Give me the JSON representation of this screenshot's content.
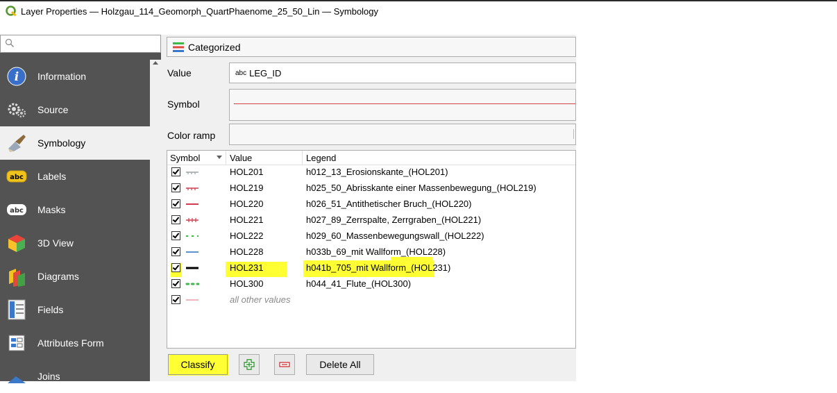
{
  "window": {
    "title": "Layer Properties — Holzgau_114_Geomorph_QuartPhaenome_25_50_Lin — Symbology"
  },
  "search": {
    "placeholder": ""
  },
  "sidebar": {
    "items": [
      {
        "label": "Information",
        "icon": "information-icon"
      },
      {
        "label": "Source",
        "icon": "source-icon"
      },
      {
        "label": "Symbology",
        "icon": "symbology-icon",
        "active": true
      },
      {
        "label": "Labels",
        "icon": "labels-icon"
      },
      {
        "label": "Masks",
        "icon": "masks-icon"
      },
      {
        "label": "3D View",
        "icon": "3d-view-icon"
      },
      {
        "label": "Diagrams",
        "icon": "diagrams-icon"
      },
      {
        "label": "Fields",
        "icon": "fields-icon"
      },
      {
        "label": "Attributes Form",
        "icon": "attributes-form-icon"
      },
      {
        "label": "Joins",
        "icon": "joins-icon"
      }
    ]
  },
  "renderer": {
    "label": "Categorized",
    "icon": "categorized-renderer-icon"
  },
  "fields": {
    "value_label": "Value",
    "value_type": "abc",
    "value": "LEG_ID",
    "symbol_label": "Symbol",
    "color_ramp_label": "Color ramp"
  },
  "table": {
    "headers": {
      "symbol": "Symbol",
      "value": "Value",
      "legend": "Legend"
    },
    "rows": [
      {
        "value": "HOL201",
        "legend": "h012_13_Erosionskante_(HOL201)",
        "color": "#9aa3a6",
        "style": "tick-line",
        "checked": true
      },
      {
        "value": "HOL219",
        "legend": "h025_50_Abrisskante einer Massenbewegung_(HOL219)",
        "color": "#d03c4c",
        "style": "tick-line",
        "checked": true
      },
      {
        "value": "HOL220",
        "legend": "h026_51_Antithetischer Bruch_(HOL220)",
        "color": "#d03c4c",
        "style": "solid",
        "checked": true
      },
      {
        "value": "HOL221",
        "legend": "h027_89_Zerrspalte, Zerrgraben_(HOL221)",
        "color": "#d03c4c",
        "style": "cross-line",
        "checked": true
      },
      {
        "value": "HOL222",
        "legend": "h029_60_Massenbewegungswall_(HOL222)",
        "color": "#3fb54a",
        "style": "dashed",
        "checked": true
      },
      {
        "value": "HOL228",
        "legend": "h033b_69_mit Wallform_(HOL228)",
        "color": "#5a94d0",
        "style": "solid",
        "checked": true
      },
      {
        "value": "HOL231",
        "legend": "h041b_705_mit Wallform_(HOL231)",
        "color": "#000000",
        "style": "thick",
        "checked": true
      },
      {
        "value": "HOL300",
        "legend": "h044_41_Flute_(HOL300)",
        "color": "#3fb54a",
        "style": "dotted",
        "checked": true,
        "highlighted": true
      },
      {
        "value": "all other values",
        "legend": "",
        "color": "#f0b4bc",
        "style": "solid",
        "checked": true,
        "other": true
      }
    ]
  },
  "buttons": {
    "classify": "Classify",
    "add": "add-class-icon",
    "remove": "remove-class-icon",
    "delete_all": "Delete All"
  },
  "colors": {
    "highlight": "#ffff33",
    "sidebar_bg": "#535353"
  }
}
